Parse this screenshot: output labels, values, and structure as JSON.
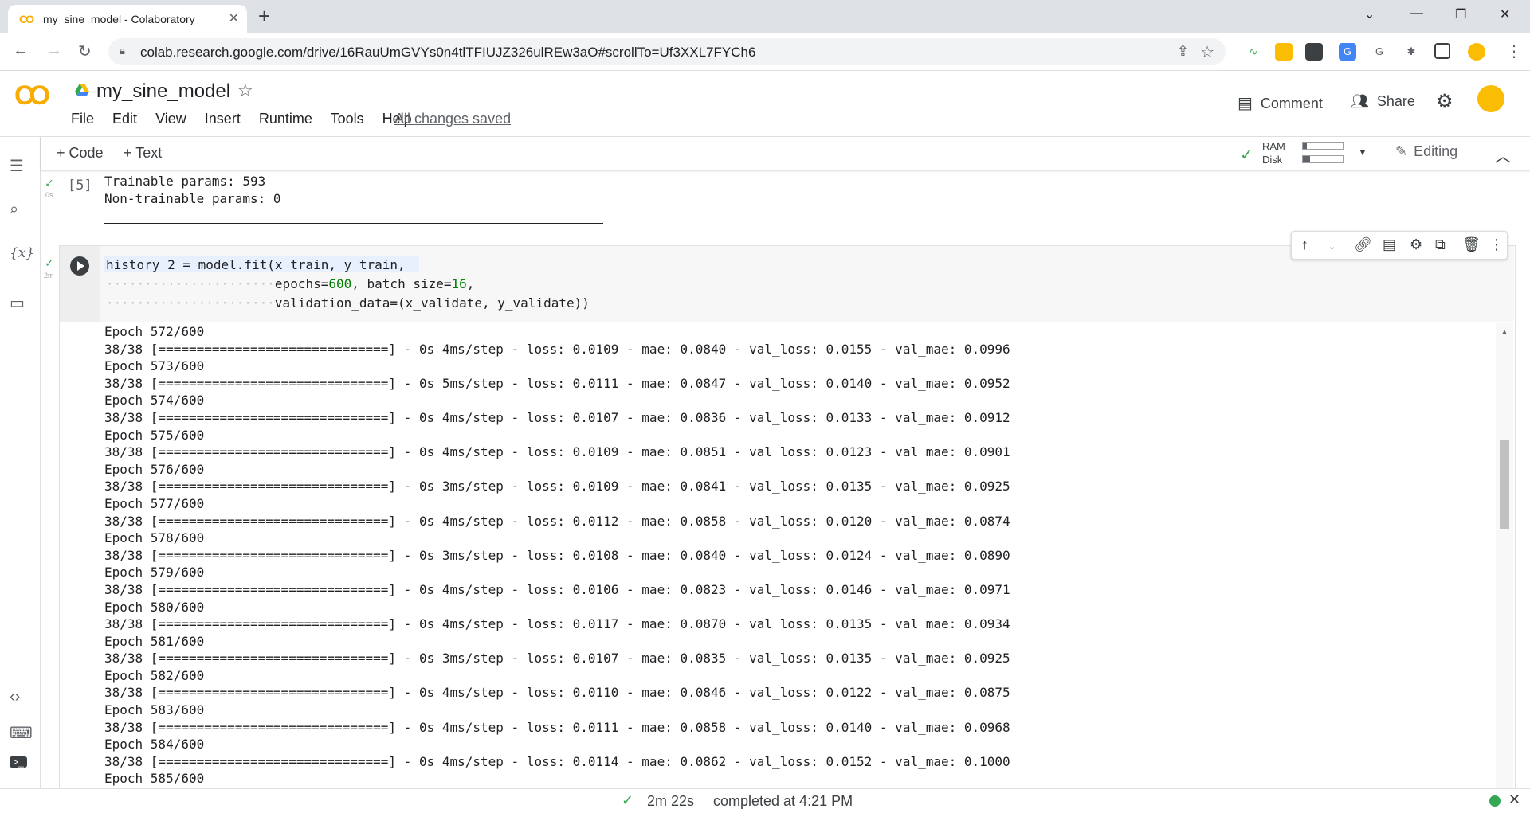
{
  "browser": {
    "tab_title": "my_sine_model - Colaboratory",
    "tab_favicon": "CO",
    "url": "colab.research.google.com/drive/16RauUmGVYs0n4tlTFIUJZ326ulREw3aO#scrollTo=Uf3XXL7FYCh6"
  },
  "colab": {
    "logo": "CO",
    "notebook_name": "my_sine_model",
    "menus": [
      "File",
      "Edit",
      "View",
      "Insert",
      "Runtime",
      "Tools",
      "Help"
    ],
    "save_status": "All changes saved",
    "comment_label": "Comment",
    "share_label": "Share"
  },
  "toolbar": {
    "add_code": "+ Code",
    "add_text": "+ Text",
    "ram_label": "RAM",
    "disk_label": "Disk",
    "ram_usage": 0.1,
    "disk_usage": 0.17,
    "editing_label": "Editing"
  },
  "prev_cell": {
    "exec_count": "[5]",
    "exec_time": "0s",
    "output_lines": [
      "Trainable params: 593",
      "Non-trainable params: 0"
    ]
  },
  "cell": {
    "exec_time": "2m",
    "code": {
      "line1": "history_2 = model.fit(x_train, y_train,",
      "line2_a": "epochs=",
      "line2_num1": "600",
      "line2_b": ", batch_size=",
      "line2_num2": "16",
      "line2_c": ",",
      "line3": "validation_data=(x_validate, y_validate))"
    },
    "output": [
      "Epoch 572/600",
      "38/38 [==============================] - 0s 4ms/step - loss: 0.0109 - mae: 0.0840 - val_loss: 0.0155 - val_mae: 0.0996",
      "Epoch 573/600",
      "38/38 [==============================] - 0s 5ms/step - loss: 0.0111 - mae: 0.0847 - val_loss: 0.0140 - val_mae: 0.0952",
      "Epoch 574/600",
      "38/38 [==============================] - 0s 4ms/step - loss: 0.0107 - mae: 0.0836 - val_loss: 0.0133 - val_mae: 0.0912",
      "Epoch 575/600",
      "38/38 [==============================] - 0s 4ms/step - loss: 0.0109 - mae: 0.0851 - val_loss: 0.0123 - val_mae: 0.0901",
      "Epoch 576/600",
      "38/38 [==============================] - 0s 3ms/step - loss: 0.0109 - mae: 0.0841 - val_loss: 0.0135 - val_mae: 0.0925",
      "Epoch 577/600",
      "38/38 [==============================] - 0s 4ms/step - loss: 0.0112 - mae: 0.0858 - val_loss: 0.0120 - val_mae: 0.0874",
      "Epoch 578/600",
      "38/38 [==============================] - 0s 3ms/step - loss: 0.0108 - mae: 0.0840 - val_loss: 0.0124 - val_mae: 0.0890",
      "Epoch 579/600",
      "38/38 [==============================] - 0s 4ms/step - loss: 0.0106 - mae: 0.0823 - val_loss: 0.0146 - val_mae: 0.0971",
      "Epoch 580/600",
      "38/38 [==============================] - 0s 4ms/step - loss: 0.0117 - mae: 0.0870 - val_loss: 0.0135 - val_mae: 0.0934",
      "Epoch 581/600",
      "38/38 [==============================] - 0s 3ms/step - loss: 0.0107 - mae: 0.0835 - val_loss: 0.0135 - val_mae: 0.0925",
      "Epoch 582/600",
      "38/38 [==============================] - 0s 4ms/step - loss: 0.0110 - mae: 0.0846 - val_loss: 0.0122 - val_mae: 0.0875",
      "Epoch 583/600",
      "38/38 [==============================] - 0s 4ms/step - loss: 0.0111 - mae: 0.0858 - val_loss: 0.0140 - val_mae: 0.0968",
      "Epoch 584/600",
      "38/38 [==============================] - 0s 4ms/step - loss: 0.0114 - mae: 0.0862 - val_loss: 0.0152 - val_mae: 0.1000",
      "Epoch 585/600"
    ]
  },
  "status_bar": {
    "elapsed": "2m 22s",
    "completed": "completed at 4:21 PM"
  },
  "colors": {
    "accent": "#f9ab00",
    "ok": "#34a853",
    "number": "#008000"
  }
}
